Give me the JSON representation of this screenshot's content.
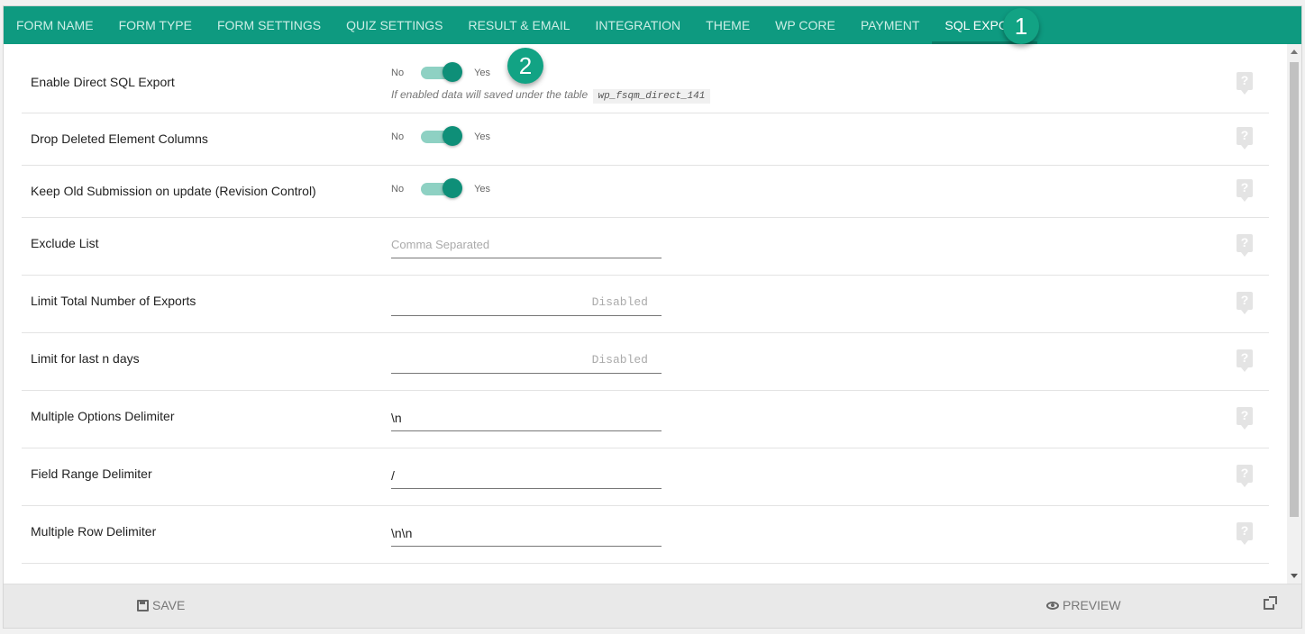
{
  "tabs": [
    {
      "label": "FORM NAME",
      "active": false
    },
    {
      "label": "FORM TYPE",
      "active": false
    },
    {
      "label": "FORM SETTINGS",
      "active": false
    },
    {
      "label": "QUIZ SETTINGS",
      "active": false
    },
    {
      "label": "RESULT & EMAIL",
      "active": false
    },
    {
      "label": "INTEGRATION",
      "active": false
    },
    {
      "label": "THEME",
      "active": false
    },
    {
      "label": "WP CORE",
      "active": false
    },
    {
      "label": "PAYMENT",
      "active": false
    },
    {
      "label": "SQL EXPORT",
      "active": true
    }
  ],
  "badges": {
    "one": "1",
    "two": "2"
  },
  "settings": {
    "enable_sql": {
      "label": "Enable Direct SQL Export",
      "no": "No",
      "yes": "Yes",
      "hint": "If enabled data will saved under the table",
      "table": "wp_fsqm_direct_141",
      "enabled": true
    },
    "drop_deleted": {
      "label": "Drop Deleted Element Columns",
      "no": "No",
      "yes": "Yes",
      "enabled": true
    },
    "keep_old": {
      "label": "Keep Old Submission on update (Revision Control)",
      "no": "No",
      "yes": "Yes",
      "enabled": true
    },
    "exclude_list": {
      "label": "Exclude List",
      "placeholder": "Comma Separated",
      "value": ""
    },
    "limit_total": {
      "label": "Limit Total Number of Exports",
      "placeholder": "Disabled"
    },
    "limit_days": {
      "label": "Limit for last n days",
      "placeholder": "Disabled"
    },
    "multi_options": {
      "label": "Multiple Options Delimiter",
      "value": "\\n"
    },
    "field_range": {
      "label": "Field Range Delimiter",
      "value": "/"
    },
    "multi_row": {
      "label": "Multiple Row Delimiter",
      "value": "\\n\\n"
    }
  },
  "footer": {
    "save": "SAVE",
    "preview": "PREVIEW"
  },
  "colors": {
    "accent": "#0e9a80",
    "knob": "#0e8f78",
    "track": "#8ed1c3"
  }
}
